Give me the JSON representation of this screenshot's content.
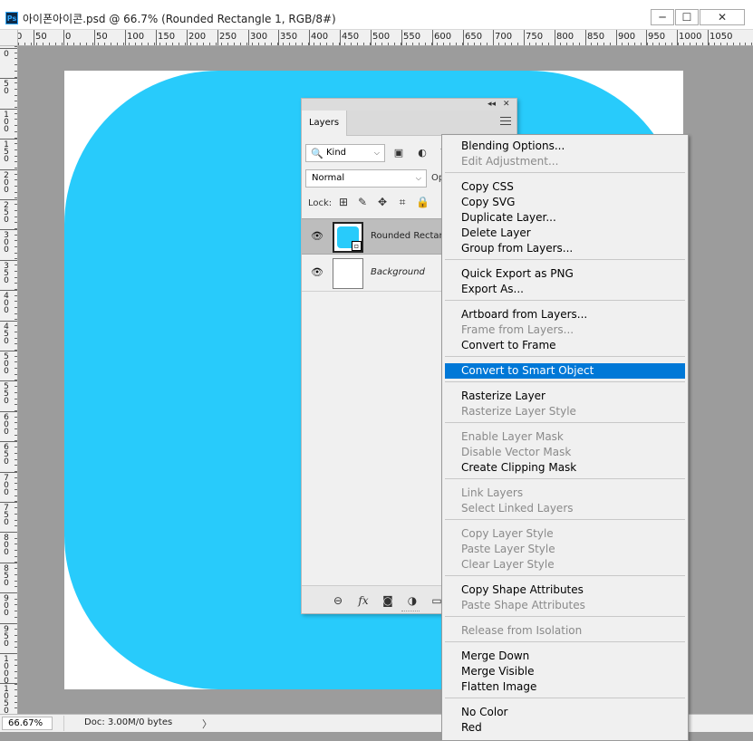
{
  "window": {
    "title": "아이폰아이콘.psd @ 66.7% (Rounded Rectangle 1, RGB/8#)",
    "app_icon": "Ps",
    "minimize": "─",
    "maximize": "☐",
    "close": "✕"
  },
  "ruler": {
    "h_labels": [
      "0",
      "50",
      "0",
      "50",
      "100",
      "150",
      "200",
      "250",
      "300",
      "350",
      "400",
      "450",
      "500",
      "550",
      "600",
      "650",
      "700",
      "750",
      "800",
      "850",
      "900",
      "950",
      "1000",
      "1050"
    ],
    "v_labels": [
      "0",
      "5 0",
      "1 0 0",
      "1 5 0",
      "2 0 0",
      "2 5 0",
      "3 0 0",
      "3 5 0",
      "4 0 0",
      "4 5 0",
      "5 0 0",
      "5 5 0",
      "6 0 0",
      "6 5 0",
      "7 0 0",
      "7 5 0",
      "8 0 0",
      "8 5 0",
      "9 0 0",
      "9 5 0",
      "1 0 0 0",
      "1 0 5 0"
    ]
  },
  "canvas": {
    "shape_color": "#28cbfb",
    "document_color": "#ffffff"
  },
  "status": {
    "zoom": "66.67%",
    "doc_info": "Doc: 3.00M/0 bytes",
    "arrow": "〉"
  },
  "layers_panel": {
    "tab": "Layers",
    "collapse_glyph": "◂◂",
    "close_glyph": "✕",
    "filter": {
      "value": "Kind",
      "search_glyph": "🔍"
    },
    "filter_icons": [
      "▣",
      "◐",
      "T"
    ],
    "blend_mode": "Normal",
    "opacity_label": "Op",
    "lock_label": "Lock:",
    "lock_icons": [
      "⊞",
      "✎",
      "✥",
      "⌗",
      "🔒"
    ],
    "layers": [
      {
        "name": "Rounded Rectangle 1",
        "visible_glyph": "👁",
        "selected": true
      },
      {
        "name": "Background",
        "visible_glyph": "👁",
        "selected": false
      }
    ],
    "footer_icons": [
      "⊖",
      "fx",
      "◙",
      "◑",
      "▭"
    ]
  },
  "context_menu": {
    "items": [
      {
        "label": "Blending Options...",
        "enabled": true
      },
      {
        "label": "Edit Adjustment...",
        "enabled": false
      },
      {
        "label": "Copy CSS",
        "enabled": true
      },
      {
        "label": "Copy SVG",
        "enabled": true
      },
      {
        "label": "Duplicate Layer...",
        "enabled": true
      },
      {
        "label": "Delete Layer",
        "enabled": true
      },
      {
        "label": "Group from Layers...",
        "enabled": true
      },
      {
        "label": "Quick Export as PNG",
        "enabled": true
      },
      {
        "label": "Export As...",
        "enabled": true
      },
      {
        "label": "Artboard from Layers...",
        "enabled": true
      },
      {
        "label": "Frame from Layers...",
        "enabled": false
      },
      {
        "label": "Convert to Frame",
        "enabled": true
      },
      {
        "label": "Convert to Smart Object",
        "enabled": true,
        "highlighted": true
      },
      {
        "label": "Rasterize Layer",
        "enabled": true
      },
      {
        "label": "Rasterize Layer Style",
        "enabled": false
      },
      {
        "label": "Enable Layer Mask",
        "enabled": false
      },
      {
        "label": "Disable Vector Mask",
        "enabled": false
      },
      {
        "label": "Create Clipping Mask",
        "enabled": true
      },
      {
        "label": "Link Layers",
        "enabled": false
      },
      {
        "label": "Select Linked Layers",
        "enabled": false
      },
      {
        "label": "Copy Layer Style",
        "enabled": false
      },
      {
        "label": "Paste Layer Style",
        "enabled": false
      },
      {
        "label": "Clear Layer Style",
        "enabled": false
      },
      {
        "label": "Copy Shape Attributes",
        "enabled": true
      },
      {
        "label": "Paste Shape Attributes",
        "enabled": false
      },
      {
        "label": "Release from Isolation",
        "enabled": false
      },
      {
        "label": "Merge Down",
        "enabled": true
      },
      {
        "label": "Merge Visible",
        "enabled": true
      },
      {
        "label": "Flatten Image",
        "enabled": true
      },
      {
        "label": "No Color",
        "enabled": true
      },
      {
        "label": "Red",
        "enabled": true
      }
    ],
    "highlight_color": "#0078d7"
  }
}
